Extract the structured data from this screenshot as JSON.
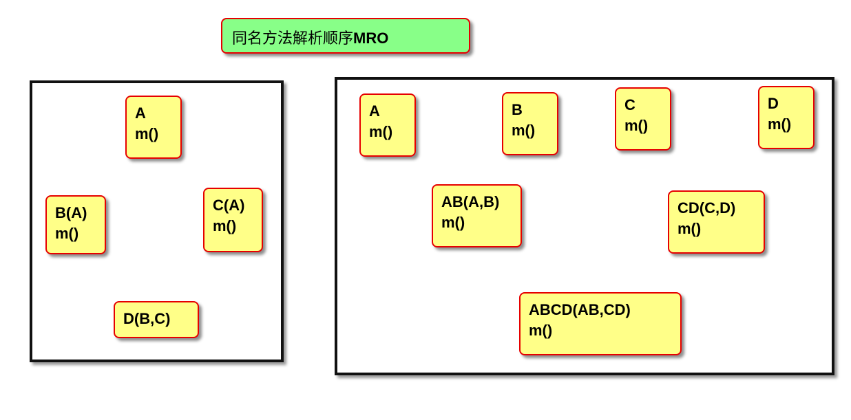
{
  "title": {
    "cjk": "同名方法解析顺序",
    "latin": "MRO"
  },
  "left_diagram": {
    "nodes": [
      {
        "id": "A",
        "name": "A",
        "method": "m()"
      },
      {
        "id": "B",
        "name": "B(A)",
        "method": "m()"
      },
      {
        "id": "C",
        "name": "C(A)",
        "method": "m()"
      },
      {
        "id": "D",
        "name": "D(B,C)",
        "method": ""
      }
    ]
  },
  "right_diagram": {
    "nodes": [
      {
        "id": "A",
        "name": "A",
        "method": "m()"
      },
      {
        "id": "B",
        "name": "B",
        "method": "m()"
      },
      {
        "id": "C",
        "name": "C",
        "method": "m()"
      },
      {
        "id": "D",
        "name": "D",
        "method": "m()"
      },
      {
        "id": "AB",
        "name": "AB(A,B)",
        "method": "m()"
      },
      {
        "id": "CD",
        "name": "CD(C,D)",
        "method": "m()"
      },
      {
        "id": "ABCD",
        "name": "ABCD(AB,CD)",
        "method": "m()"
      }
    ]
  },
  "colors": {
    "title_fill": "#88ff88",
    "node_fill": "#ffff88",
    "node_border": "#e60000",
    "frame_border": "#111111"
  }
}
